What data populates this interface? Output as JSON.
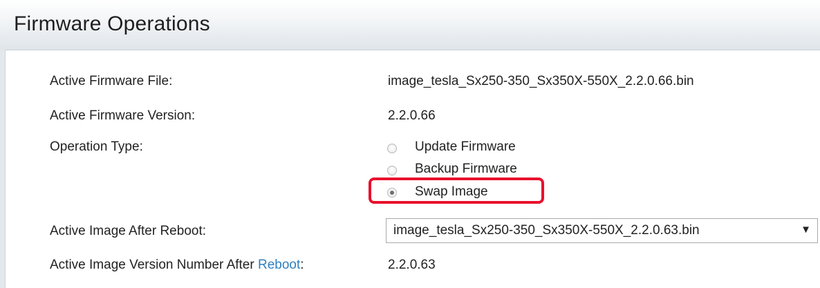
{
  "page": {
    "title": "Firmware Operations"
  },
  "fields": {
    "active_file_label": "Active Firmware File:",
    "active_file_value": "image_tesla_Sx250-350_Sx350X-550X_2.2.0.66.bin",
    "active_version_label": "Active Firmware Version:",
    "active_version_value": "2.2.0.66",
    "operation_type_label": "Operation Type:",
    "operation_options": [
      {
        "label": "Update Firmware",
        "checked": false
      },
      {
        "label": "Backup Firmware",
        "checked": false
      },
      {
        "label": "Swap Image",
        "checked": true
      }
    ],
    "active_image_after_reboot_label": "Active Image After Reboot:",
    "active_image_after_reboot_value": "image_tesla_Sx250-350_Sx350X-550X_2.2.0.63.bin",
    "select_arrow": "▼",
    "version_after_reboot_label_prefix": "Active Image Version Number After ",
    "version_after_reboot_link": "Reboot",
    "version_after_reboot_colon": ":",
    "version_after_reboot_value": "2.2.0.63"
  },
  "colors": {
    "highlight": "#e8112d",
    "link": "#2f7fc1"
  }
}
